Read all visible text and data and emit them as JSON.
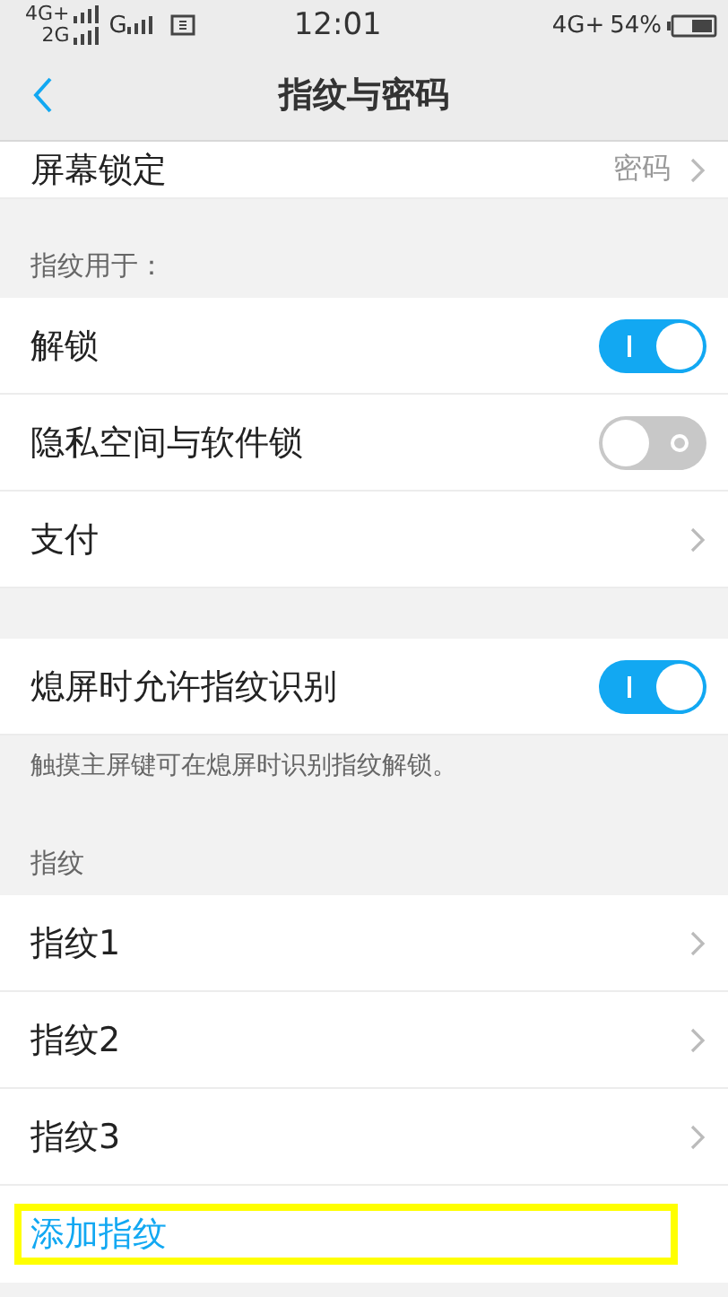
{
  "status_bar": {
    "signal_labels": [
      "4G+",
      "2G",
      "G"
    ],
    "time": "12:01",
    "network": "4G+",
    "battery": "54%"
  },
  "header": {
    "title": "指纹与密码"
  },
  "lock_row": {
    "label": "屏幕锁定",
    "value": "密码"
  },
  "sections": [
    {
      "header": "指纹用于：",
      "rows": [
        {
          "kind": "toggle",
          "label": "解锁",
          "on": true
        },
        {
          "kind": "toggle",
          "label": "隐私空间与软件锁",
          "on": false
        },
        {
          "kind": "link",
          "label": "支付"
        }
      ]
    },
    {
      "rows": [
        {
          "kind": "toggle",
          "label": "熄屏时允许指纹识别",
          "on": true
        }
      ],
      "note": "触摸主屏键可在熄屏时识别指纹解锁。"
    },
    {
      "header": "指纹",
      "rows": [
        {
          "kind": "link",
          "label": "指纹1"
        },
        {
          "kind": "link",
          "label": "指纹2"
        },
        {
          "kind": "link",
          "label": "指纹3"
        },
        {
          "kind": "action",
          "label": "添加指纹",
          "highlighted": true
        }
      ]
    }
  ]
}
